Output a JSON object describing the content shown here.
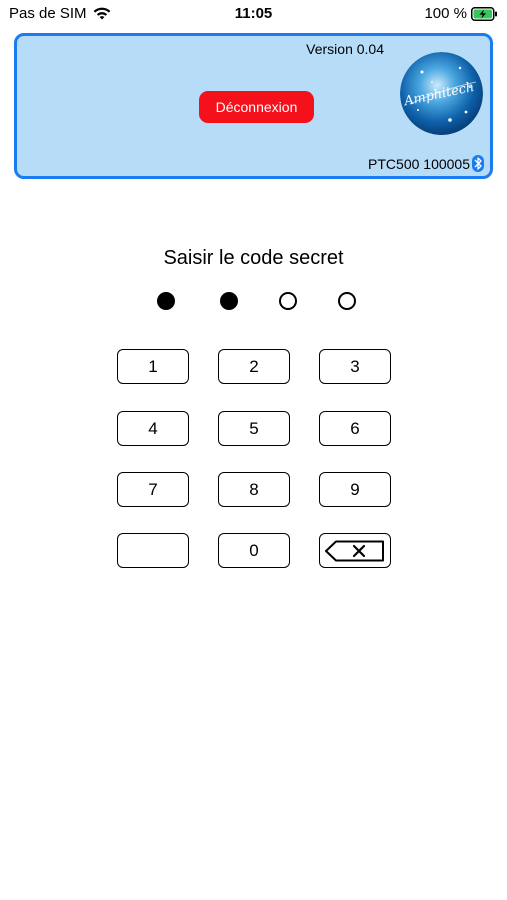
{
  "status_bar": {
    "carrier": "Pas de SIM",
    "time": "11:05",
    "battery_percent": "100 %",
    "icons": [
      "wifi-icon",
      "battery-charging-icon"
    ]
  },
  "header": {
    "version": "Version 0.04",
    "logout_label": "Déconnexion",
    "logo_text": "Amphitech",
    "device": "PTC500 100005",
    "device_icon": "bluetooth-icon",
    "colors": {
      "background": "#b7dcf7",
      "border": "#1a7cf0",
      "logout_button": "#f4111b"
    }
  },
  "pin": {
    "prompt": "Saisir le code secret",
    "length": 4,
    "entered": 2
  },
  "keypad": {
    "keys": [
      "1",
      "2",
      "3",
      "4",
      "5",
      "6",
      "7",
      "8",
      "9",
      "",
      "0",
      "backspace-icon"
    ]
  }
}
